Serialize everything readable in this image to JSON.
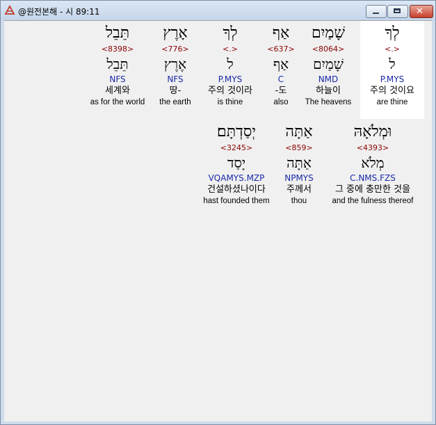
{
  "window": {
    "title": "@원전본해 - 시 89:11",
    "minimize_glyph": "",
    "maximize_glyph": "",
    "close_glyph": "✕"
  },
  "lines": [
    {
      "words": [
        {
          "hebrew": "לְךָ",
          "strong": "<.>",
          "lemma": "ל",
          "morph": "P.MYS",
          "korean": "주의 것이요",
          "english": "are thine",
          "highlighted": true
        },
        {
          "hebrew": "שָׁמַיִם",
          "strong": "<8064>",
          "lemma": "שָׁמַיִם",
          "morph": "NMD",
          "korean": "하늘이",
          "english": "The heavens"
        },
        {
          "hebrew": "אַף",
          "strong": "<637>",
          "lemma": "אַף",
          "morph": "C",
          "korean": "-도",
          "english": "also"
        },
        {
          "hebrew": "לְךָ",
          "strong": "<.>",
          "lemma": "ל",
          "morph": "P.MYS",
          "korean": "주의 것이라",
          "english": "is thine"
        },
        {
          "hebrew": "אָרֶץ",
          "strong": "<776>",
          "lemma": "אֶרֶץ",
          "morph": "NFS",
          "korean": "땅-",
          "english": "the earth"
        },
        {
          "hebrew": "תֵּבֵל",
          "strong": "<8398>",
          "lemma": "תֵּבֵל",
          "morph": "NFS",
          "korean": "세계와",
          "english": "as for the world"
        }
      ]
    },
    {
      "words": [
        {
          "hebrew": "וּמְלֹאָהּ",
          "strong": "<4393>",
          "lemma": "מְלֹא",
          "morph": "C.NMS.FZS",
          "korean": "그 중에 충만한 것을",
          "english": "and the fulness thereof"
        },
        {
          "hebrew": "אַתָּה",
          "strong": "<859>",
          "lemma": "אַתָּה",
          "morph": "NPMYS",
          "korean": "주께서",
          "english": "thou"
        },
        {
          "hebrew": "יְסַדְתָּם׃",
          "strong": "<3245>",
          "lemma": "יָסַד",
          "morph": "VQAMYS.MZP",
          "korean": "건설하셨나이다",
          "english": "hast founded them"
        }
      ]
    }
  ]
}
